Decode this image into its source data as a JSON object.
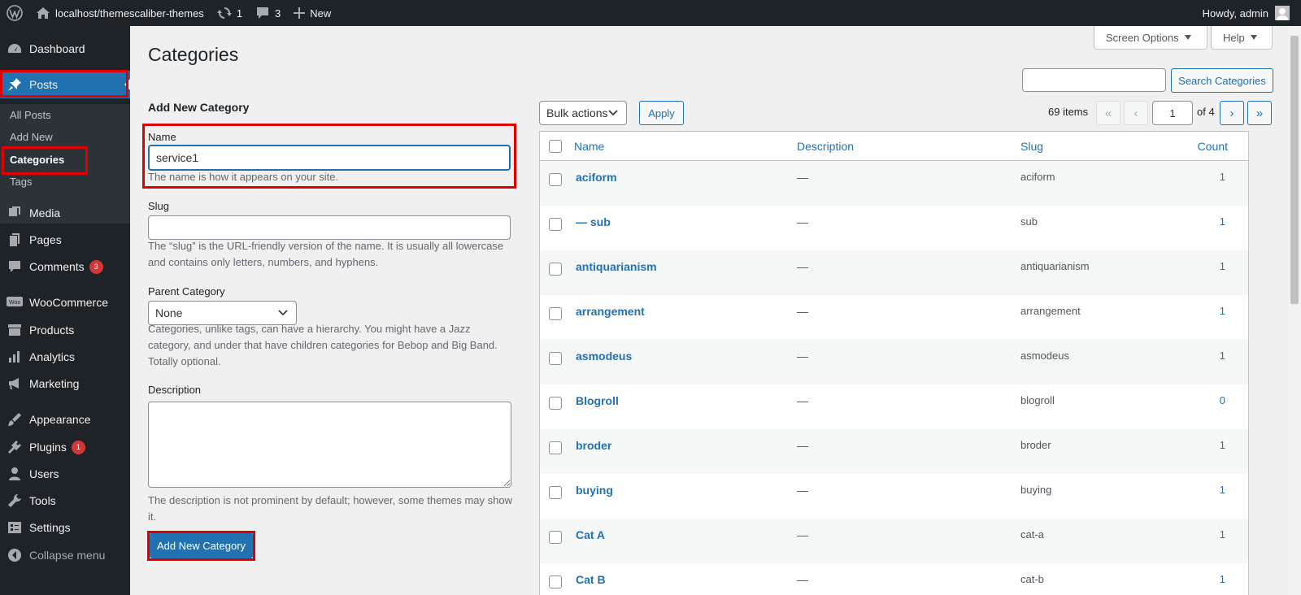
{
  "adminbar": {
    "site_name": "localhost/themescaliber-themes",
    "updates_count": "1",
    "comments_count": "3",
    "new_label": "New",
    "howdy": "Howdy, admin"
  },
  "sidebar": {
    "dashboard": "Dashboard",
    "posts": "Posts",
    "submenu": {
      "all_posts": "All Posts",
      "add_new": "Add New",
      "categories": "Categories",
      "tags": "Tags"
    },
    "media": "Media",
    "pages": "Pages",
    "comments": "Comments",
    "comments_badge": "3",
    "woocommerce": "WooCommerce",
    "products": "Products",
    "analytics": "Analytics",
    "marketing": "Marketing",
    "appearance": "Appearance",
    "plugins": "Plugins",
    "plugins_badge": "1",
    "users": "Users",
    "tools": "Tools",
    "settings": "Settings",
    "collapse": "Collapse menu"
  },
  "header": {
    "title": "Categories",
    "screen_options": "Screen Options",
    "help": "Help"
  },
  "search": {
    "button": "Search Categories",
    "value": ""
  },
  "form": {
    "heading": "Add New Category",
    "name_label": "Name",
    "name_value": "service1",
    "name_help": "The name is how it appears on your site.",
    "slug_label": "Slug",
    "slug_value": "",
    "slug_help": "The “slug” is the URL-friendly version of the name. It is usually all lowercase and contains only letters, numbers, and hyphens.",
    "parent_label": "Parent Category",
    "parent_value": "None",
    "parent_help": "Categories, unlike tags, can have a hierarchy. You might have a Jazz category, and under that have children categories for Bebop and Big Band. Totally optional.",
    "desc_label": "Description",
    "desc_value": "",
    "desc_help": "The description is not prominent by default; however, some themes may show it.",
    "submit": "Add New Category"
  },
  "tablenav": {
    "bulk_actions": "Bulk actions",
    "apply": "Apply",
    "items": "69 items",
    "first": "«",
    "prev": "‹",
    "current_page": "1",
    "of_pages": "of 4",
    "next": "›",
    "last": "»"
  },
  "table": {
    "columns": {
      "name": "Name",
      "description": "Description",
      "slug": "Slug",
      "count": "Count"
    },
    "rows": [
      {
        "name": "aciform",
        "description": "—",
        "slug": "aciform",
        "count": "1"
      },
      {
        "name": "— sub",
        "description": "—",
        "slug": "sub",
        "count": "1"
      },
      {
        "name": "antiquarianism",
        "description": "—",
        "slug": "antiquarianism",
        "count": "1"
      },
      {
        "name": "arrangement",
        "description": "—",
        "slug": "arrangement",
        "count": "1"
      },
      {
        "name": "asmodeus",
        "description": "—",
        "slug": "asmodeus",
        "count": "1"
      },
      {
        "name": "Blogroll",
        "description": "—",
        "slug": "blogroll",
        "count": "0"
      },
      {
        "name": "broder",
        "description": "—",
        "slug": "broder",
        "count": "1"
      },
      {
        "name": "buying",
        "description": "—",
        "slug": "buying",
        "count": "1"
      },
      {
        "name": "Cat A",
        "description": "—",
        "slug": "cat-a",
        "count": "1"
      },
      {
        "name": "Cat B",
        "description": "—",
        "slug": "cat-b",
        "count": "1"
      }
    ]
  },
  "colors": {
    "accent": "#2271b1",
    "adminbar": "#1d2327",
    "highlight": "#e00000",
    "badge": "#d63638"
  }
}
